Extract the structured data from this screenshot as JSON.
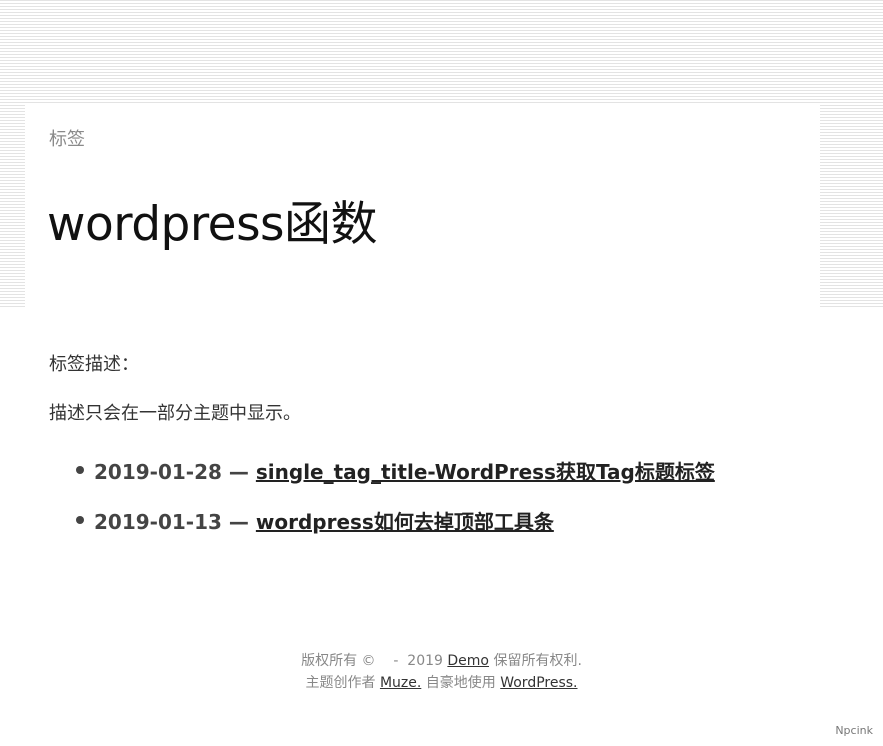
{
  "header": {
    "kicker": "标签",
    "title": "wordpress函数"
  },
  "description": {
    "label": "标签描述：",
    "text": "描述只会在一部分主题中显示。"
  },
  "posts": [
    {
      "date": "2019-01-28",
      "separator": " — ",
      "title": "single_tag_title-WordPress获取Tag标题标签"
    },
    {
      "date": "2019-01-13",
      "separator": " — ",
      "title": "wordpress如何去掉顶部工具条"
    }
  ],
  "footer": {
    "line1_prefix": "版权所有 ©    -  2019 ",
    "line1_link": "Demo",
    "line1_suffix": " 保留所有权利.",
    "line2_prefix": "主题创作者 ",
    "line2_link1": "Muze.",
    "line2_middle": " 自豪地使用 ",
    "line2_link2": "WordPress."
  },
  "watermark": "Npcink"
}
